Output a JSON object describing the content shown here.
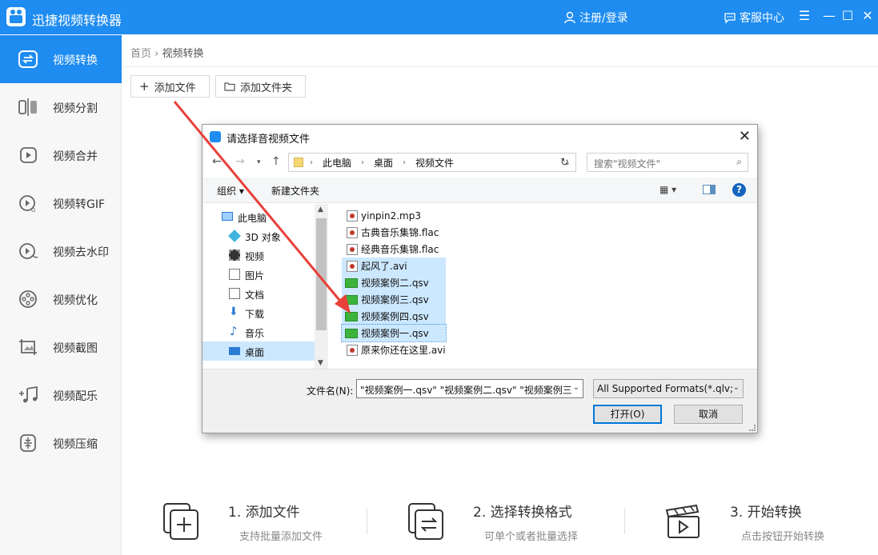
{
  "app": {
    "title": "迅捷视频转换器",
    "login": "注册/登录",
    "service": "客服中心"
  },
  "sidebar": {
    "items": [
      {
        "label": "视频转换",
        "icon": "convert-icon"
      },
      {
        "label": "视频分割",
        "icon": "split-icon"
      },
      {
        "label": "视频合并",
        "icon": "merge-icon"
      },
      {
        "label": "视频转GIF",
        "icon": "gif-icon"
      },
      {
        "label": "视频去水印",
        "icon": "watermark-icon"
      },
      {
        "label": "视频优化",
        "icon": "optimize-icon"
      },
      {
        "label": "视频截图",
        "icon": "screenshot-icon"
      },
      {
        "label": "视频配乐",
        "icon": "music-icon"
      },
      {
        "label": "视频压缩",
        "icon": "compress-icon"
      }
    ]
  },
  "breadcrumb": {
    "home": "首页",
    "separator": "›",
    "current": "视频转换"
  },
  "toolbar": {
    "add_file": "添加文件",
    "add_folder": "添加文件夹"
  },
  "steps": [
    {
      "title": "1. 添加文件",
      "desc": "支持批量添加文件"
    },
    {
      "title": "2. 选择转换格式",
      "desc": "可单个或者批量选择"
    },
    {
      "title": "3. 开始转换",
      "desc": "点击按钮开始转换"
    }
  ],
  "dialog": {
    "title": "请选择音视频文件",
    "path": [
      "此电脑",
      "桌面",
      "视频文件"
    ],
    "search_placeholder": "搜索\"视频文件\"",
    "organize": "组织 ▾",
    "new_folder": "新建文件夹",
    "tree": [
      "此电脑",
      "3D 对象",
      "视频",
      "图片",
      "文档",
      "下载",
      "音乐",
      "桌面"
    ],
    "files": [
      {
        "name": "yinpin2.mp3",
        "type": "media",
        "selected": false
      },
      {
        "name": "古典音乐集锦.flac",
        "type": "media",
        "selected": false
      },
      {
        "name": "经典音乐集锦.flac",
        "type": "media",
        "selected": false
      },
      {
        "name": "起风了.avi",
        "type": "media",
        "selected": true
      },
      {
        "name": "视频案例二.qsv",
        "type": "qsv",
        "selected": true
      },
      {
        "name": "视频案例三.qsv",
        "type": "qsv",
        "selected": true
      },
      {
        "name": "视频案例四.qsv",
        "type": "qsv",
        "selected": true
      },
      {
        "name": "视频案例一.qsv",
        "type": "qsv",
        "selected": true
      },
      {
        "name": "原来你还在这里.avi",
        "type": "media",
        "selected": false
      }
    ],
    "filename_label": "文件名(N):",
    "filename_value": "\"视频案例一.qsv\" \"视频案例二.qsv\" \"视频案例三",
    "format_value": "All Supported Formats(*.qlv;",
    "open": "打开(O)",
    "cancel": "取消"
  },
  "colors": {
    "accent": "#1e8cf0",
    "selection": "#cce8ff",
    "arrow": "#e8403a"
  }
}
